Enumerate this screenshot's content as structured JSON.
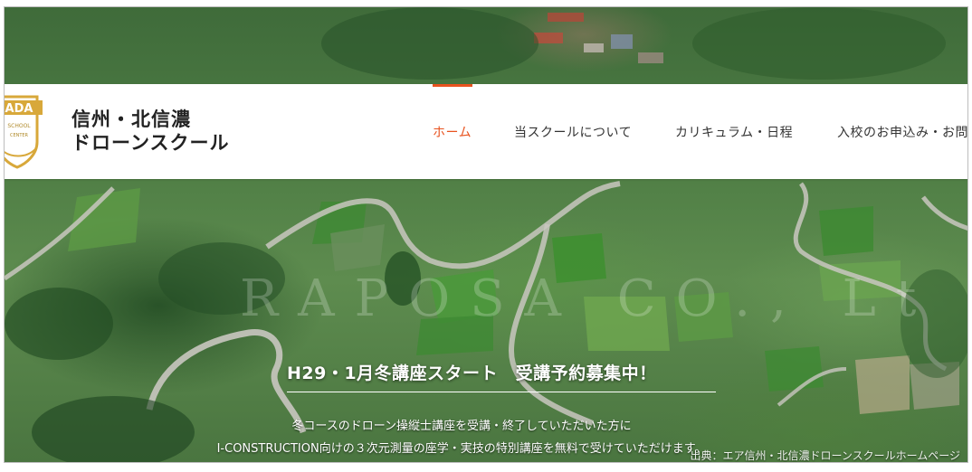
{
  "site": {
    "title_line1": "信州・北信濃",
    "title_line2": "ドローンスクール"
  },
  "logo": {
    "letters": "ADA",
    "sub_line1": "SCHOOL",
    "sub_line2": "CENTER"
  },
  "nav": {
    "items": [
      {
        "label": "ホーム",
        "active": true
      },
      {
        "label": "当スクールについて",
        "active": false
      },
      {
        "label": "カリキュラム・日程",
        "active": false
      },
      {
        "label": "入校のお申込み・お問"
      }
    ]
  },
  "hero": {
    "headline": "H29・1月冬講座スタート　受講予約募集中！",
    "description_line1": "冬コースのドローン操縦士講座を受講・終了していただいた方に",
    "description_line2": "I-CONSTRUCTION向けの３次元測量の座学・実技の特別講座を無料で受けていただけます。",
    "watermark": "RAPOSA CO., Lt",
    "credit": "出典：エア信州・北信濃ドローンスクールホームページ"
  },
  "colors": {
    "accent": "#e8531f",
    "logo_gold": "#d8a83a"
  }
}
